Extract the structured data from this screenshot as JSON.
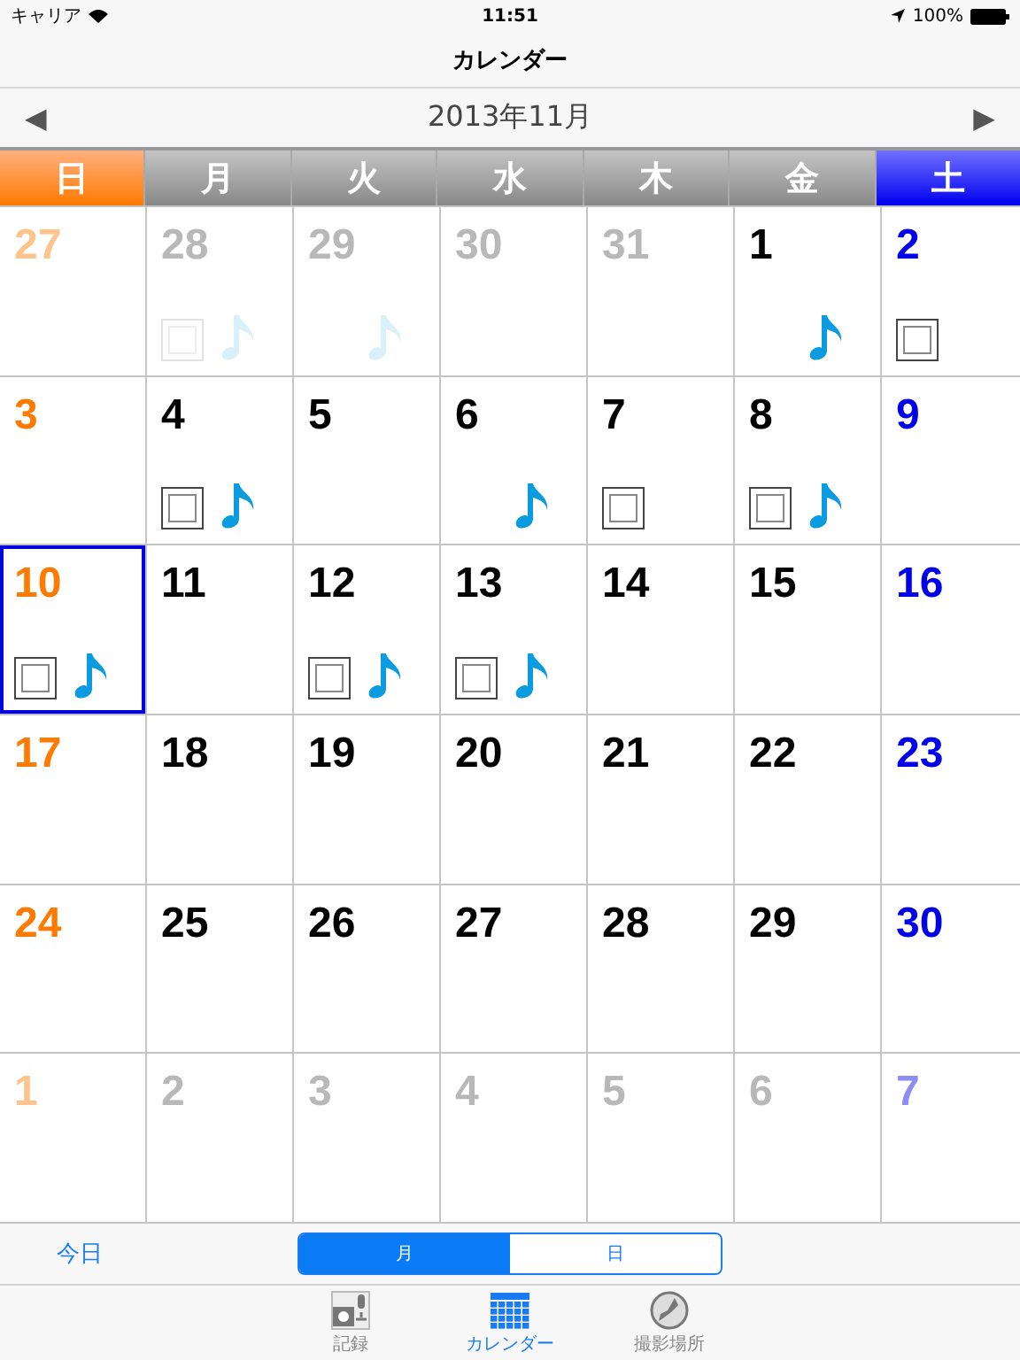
{
  "status_bar": {
    "carrier": "キャリア",
    "time": "11:51",
    "battery": "100%"
  },
  "nav_bar": {
    "title": "カレンダー"
  },
  "month_bar": {
    "title": "2013年11月",
    "prev": "◀",
    "next": "▶"
  },
  "weekdays": [
    "日",
    "月",
    "火",
    "水",
    "木",
    "金",
    "土"
  ],
  "days": [
    {
      "day": "27",
      "in_month": false,
      "selected": false,
      "photo": false,
      "audio": false
    },
    {
      "day": "28",
      "in_month": false,
      "selected": false,
      "photo": true,
      "audio": true
    },
    {
      "day": "29",
      "in_month": false,
      "selected": false,
      "photo": false,
      "audio": true
    },
    {
      "day": "30",
      "in_month": false,
      "selected": false,
      "photo": false,
      "audio": false
    },
    {
      "day": "31",
      "in_month": false,
      "selected": false,
      "photo": false,
      "audio": false
    },
    {
      "day": "1",
      "in_month": true,
      "selected": false,
      "photo": false,
      "audio": true
    },
    {
      "day": "2",
      "in_month": true,
      "selected": false,
      "photo": true,
      "audio": false
    },
    {
      "day": "3",
      "in_month": true,
      "selected": false,
      "photo": false,
      "audio": false
    },
    {
      "day": "4",
      "in_month": true,
      "selected": false,
      "photo": true,
      "audio": true
    },
    {
      "day": "5",
      "in_month": true,
      "selected": false,
      "photo": false,
      "audio": false
    },
    {
      "day": "6",
      "in_month": true,
      "selected": false,
      "photo": false,
      "audio": true
    },
    {
      "day": "7",
      "in_month": true,
      "selected": false,
      "photo": true,
      "audio": false
    },
    {
      "day": "8",
      "in_month": true,
      "selected": false,
      "photo": true,
      "audio": true
    },
    {
      "day": "9",
      "in_month": true,
      "selected": false,
      "photo": false,
      "audio": false
    },
    {
      "day": "10",
      "in_month": true,
      "selected": true,
      "photo": true,
      "audio": true
    },
    {
      "day": "11",
      "in_month": true,
      "selected": false,
      "photo": false,
      "audio": false
    },
    {
      "day": "12",
      "in_month": true,
      "selected": false,
      "photo": true,
      "audio": true
    },
    {
      "day": "13",
      "in_month": true,
      "selected": false,
      "photo": true,
      "audio": true
    },
    {
      "day": "14",
      "in_month": true,
      "selected": false,
      "photo": false,
      "audio": false
    },
    {
      "day": "15",
      "in_month": true,
      "selected": false,
      "photo": false,
      "audio": false
    },
    {
      "day": "16",
      "in_month": true,
      "selected": false,
      "photo": false,
      "audio": false
    },
    {
      "day": "17",
      "in_month": true,
      "selected": false,
      "photo": false,
      "audio": false
    },
    {
      "day": "18",
      "in_month": true,
      "selected": false,
      "photo": false,
      "audio": false
    },
    {
      "day": "19",
      "in_month": true,
      "selected": false,
      "photo": false,
      "audio": false
    },
    {
      "day": "20",
      "in_month": true,
      "selected": false,
      "photo": false,
      "audio": false
    },
    {
      "day": "21",
      "in_month": true,
      "selected": false,
      "photo": false,
      "audio": false
    },
    {
      "day": "22",
      "in_month": true,
      "selected": false,
      "photo": false,
      "audio": false
    },
    {
      "day": "23",
      "in_month": true,
      "selected": false,
      "photo": false,
      "audio": false
    },
    {
      "day": "24",
      "in_month": true,
      "selected": false,
      "photo": false,
      "audio": false
    },
    {
      "day": "25",
      "in_month": true,
      "selected": false,
      "photo": false,
      "audio": false
    },
    {
      "day": "26",
      "in_month": true,
      "selected": false,
      "photo": false,
      "audio": false
    },
    {
      "day": "27",
      "in_month": true,
      "selected": false,
      "photo": false,
      "audio": false
    },
    {
      "day": "28",
      "in_month": true,
      "selected": false,
      "photo": false,
      "audio": false
    },
    {
      "day": "29",
      "in_month": true,
      "selected": false,
      "photo": false,
      "audio": false
    },
    {
      "day": "30",
      "in_month": true,
      "selected": false,
      "photo": false,
      "audio": false
    },
    {
      "day": "1",
      "in_month": false,
      "selected": false,
      "photo": false,
      "audio": false
    },
    {
      "day": "2",
      "in_month": false,
      "selected": false,
      "photo": false,
      "audio": false
    },
    {
      "day": "3",
      "in_month": false,
      "selected": false,
      "photo": false,
      "audio": false
    },
    {
      "day": "4",
      "in_month": false,
      "selected": false,
      "photo": false,
      "audio": false
    },
    {
      "day": "5",
      "in_month": false,
      "selected": false,
      "photo": false,
      "audio": false
    },
    {
      "day": "6",
      "in_month": false,
      "selected": false,
      "photo": false,
      "audio": false
    },
    {
      "day": "7",
      "in_month": false,
      "selected": false,
      "photo": false,
      "audio": false
    }
  ],
  "toolbar": {
    "today": "今日",
    "segments": [
      {
        "label": "月",
        "selected": true
      },
      {
        "label": "日",
        "selected": false
      }
    ]
  },
  "tab_bar": [
    {
      "label": "記録",
      "kind": "record",
      "selected": false
    },
    {
      "label": "カレンダー",
      "kind": "calendar",
      "selected": true
    },
    {
      "label": "撮影場所",
      "kind": "map",
      "selected": false
    }
  ]
}
